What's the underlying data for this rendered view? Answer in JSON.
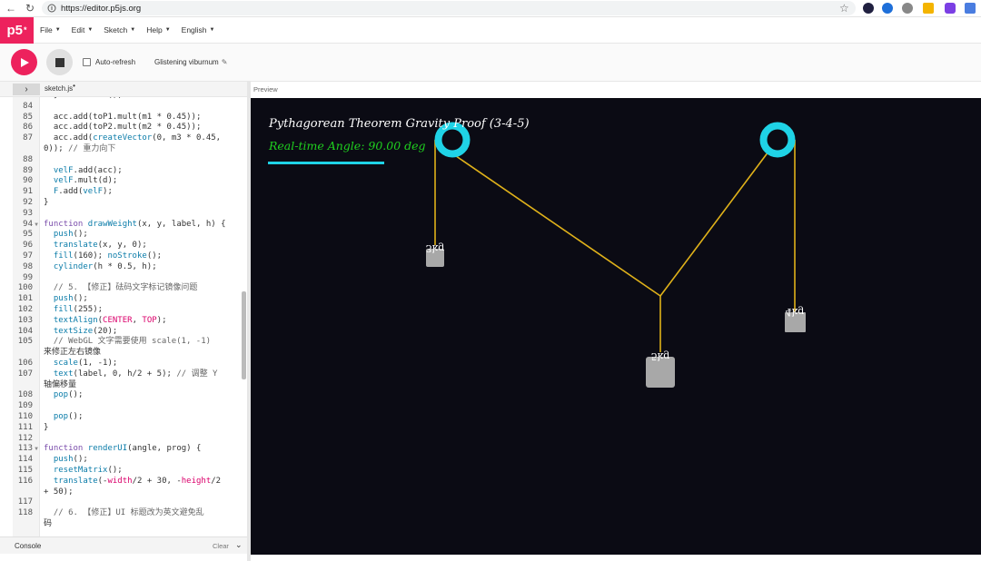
{
  "browser": {
    "url": "https://editor.p5js.org"
  },
  "app": {
    "logo": "p5",
    "logo_sup": "*",
    "menus": [
      "File",
      "Edit",
      "Sketch",
      "Help",
      "English"
    ]
  },
  "toolbar": {
    "autorefresh_label": "Auto-refresh",
    "sketch_name": "Glistening viburnum"
  },
  "editor": {
    "tab_file": "sketch.js",
    "tab_unsaved": "•",
    "lines": [
      {
        "n": "",
        "t": "  }.normalize();"
      },
      {
        "n": "84",
        "t": ""
      },
      {
        "n": "85",
        "t": "  acc.add(toP1.mult(m1 * 0.45));"
      },
      {
        "n": "86",
        "t": "  acc.add(toP2.mult(m2 * 0.45));"
      },
      {
        "n": "87",
        "t": "  acc.add(createVector(0, m3 * 0.45,"
      },
      {
        "n": "",
        "t": "0)); // 重力向下"
      },
      {
        "n": "88",
        "t": ""
      },
      {
        "n": "89",
        "t": "  velF.add(acc);"
      },
      {
        "n": "90",
        "t": "  velF.mult(d);"
      },
      {
        "n": "91",
        "t": "  F.add(velF);"
      },
      {
        "n": "92",
        "t": "}"
      },
      {
        "n": "93",
        "t": ""
      },
      {
        "n": "94",
        "t": "function drawWeight(x, y, label, h) {",
        "fold": true
      },
      {
        "n": "95",
        "t": "  push();"
      },
      {
        "n": "96",
        "t": "  translate(x, y, 0);"
      },
      {
        "n": "97",
        "t": "  fill(160); noStroke();"
      },
      {
        "n": "98",
        "t": "  cylinder(h * 0.5, h);"
      },
      {
        "n": "99",
        "t": ""
      },
      {
        "n": "100",
        "t": "  // 5. 【修正】砝码文字标记镜像问题"
      },
      {
        "n": "101",
        "t": "  push();"
      },
      {
        "n": "102",
        "t": "  fill(255);"
      },
      {
        "n": "103",
        "t": "  textAlign(CENTER, TOP);"
      },
      {
        "n": "104",
        "t": "  textSize(20);"
      },
      {
        "n": "105",
        "t": "  // WebGL 文字需要使用 scale(1, -1)"
      },
      {
        "n": "",
        "t": "来修正左右镜像"
      },
      {
        "n": "106",
        "t": "  scale(1, -1);"
      },
      {
        "n": "107",
        "t": "  text(label, 0, h/2 + 5); // 调整 Y"
      },
      {
        "n": "",
        "t": "轴偏移量"
      },
      {
        "n": "108",
        "t": "  pop();"
      },
      {
        "n": "109",
        "t": ""
      },
      {
        "n": "110",
        "t": "  pop();"
      },
      {
        "n": "111",
        "t": "}"
      },
      {
        "n": "112",
        "t": ""
      },
      {
        "n": "113",
        "t": "function renderUI(angle, prog) {",
        "fold": true
      },
      {
        "n": "114",
        "t": "  push();"
      },
      {
        "n": "115",
        "t": "  resetMatrix();"
      },
      {
        "n": "116",
        "t": "  translate(-width/2 + 30, -height/2"
      },
      {
        "n": "",
        "t": "+ 50);"
      },
      {
        "n": "117",
        "t": ""
      },
      {
        "n": "118",
        "t": "  // 6. 【修正】UI 标题改为英文避免乱"
      },
      {
        "n": "",
        "t": "码"
      }
    ]
  },
  "console": {
    "label": "Console",
    "clear": "Clear"
  },
  "preview": {
    "label": "Preview",
    "title": "Pythagorean Theorem Gravity Proof (3-4-5)",
    "angle_text": "Real-time Angle: 90.00 deg",
    "weight_labels": [
      "3kg",
      "5kg",
      "4kg"
    ],
    "colors": {
      "bg": "#0b0b14",
      "pulley": "#1fd3e6",
      "string": "#e0b21a",
      "weight": "#a8a8a8",
      "angle_text": "#1fd01f",
      "title_text": "#ffffff"
    }
  }
}
